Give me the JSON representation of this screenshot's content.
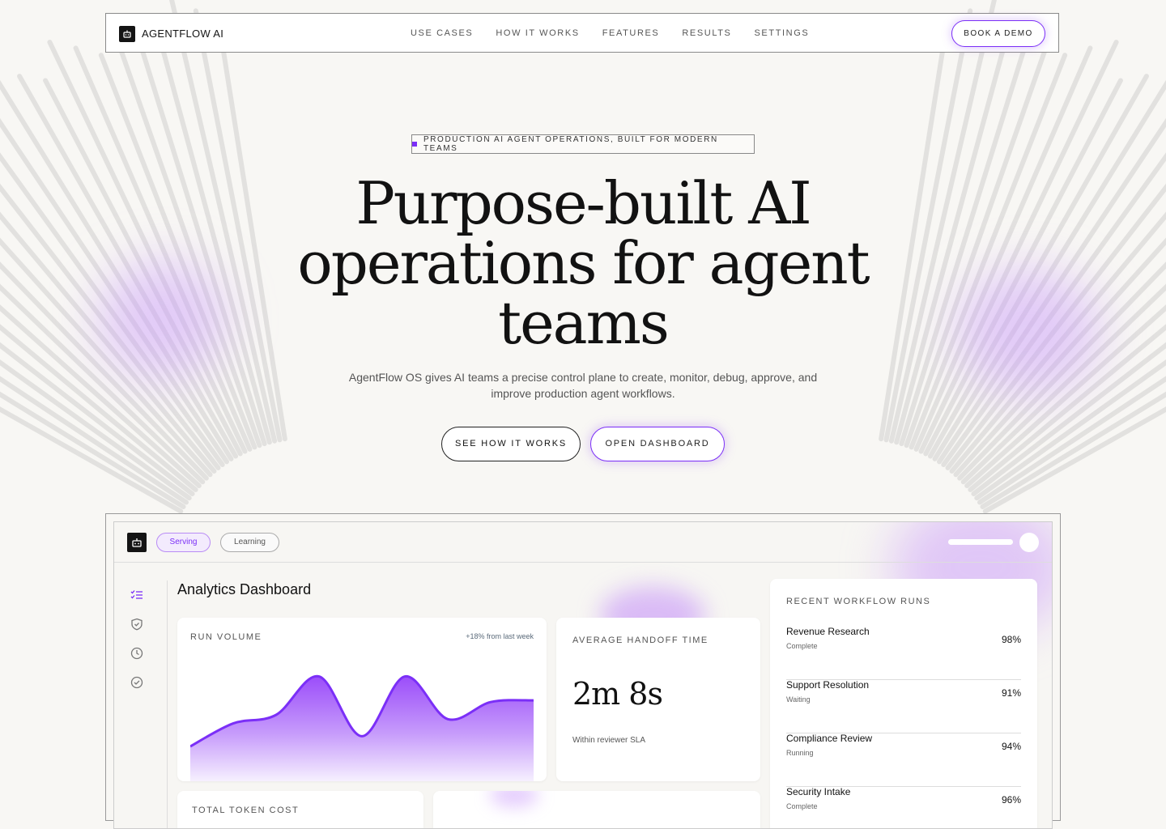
{
  "nav": {
    "brand": "AGENTFLOW AI",
    "links": [
      "USE CASES",
      "HOW IT WORKS",
      "FEATURES",
      "RESULTS",
      "SETTINGS"
    ],
    "cta": "BOOK A DEMO"
  },
  "hero": {
    "eyebrow": "PRODUCTION AI AGENT OPERATIONS, BUILT FOR MODERN TEAMS",
    "headline": "Purpose-built AI operations for agent teams",
    "subtitle": "AgentFlow OS gives AI teams a precise control plane to create, monitor, debug, approve, and improve production agent workflows.",
    "primary_cta": "SEE HOW IT WORKS",
    "secondary_cta": "OPEN DASHBOARD"
  },
  "dashboard": {
    "tabs": [
      "Serving",
      "Learning"
    ],
    "active_tab": "Serving",
    "sidebar_icons": [
      "checklist-icon",
      "shield-icon",
      "clock-icon",
      "check-circle-icon"
    ],
    "title": "Analytics Dashboard",
    "run_volume": {
      "label": "RUN VOLUME",
      "change": "+18% from last week"
    },
    "handoff": {
      "label": "AVERAGE HANDOFF TIME",
      "value": "2m 8s",
      "note": "Within reviewer SLA"
    },
    "cost_label": "TOTAL TOKEN COST",
    "recent_runs": {
      "label": "RECENT WORKFLOW RUNS",
      "items": [
        {
          "name": "Revenue Research",
          "status": "Complete",
          "score": "98%"
        },
        {
          "name": "Support Resolution",
          "status": "Waiting",
          "score": "91%"
        },
        {
          "name": "Compliance Review",
          "status": "Running",
          "score": "94%"
        },
        {
          "name": "Security Intake",
          "status": "Complete",
          "score": "96%"
        }
      ]
    }
  },
  "chart_data": {
    "type": "area",
    "title": "RUN VOLUME",
    "x": [
      0,
      1,
      2,
      3,
      4,
      5,
      6,
      7,
      8
    ],
    "values": [
      18,
      45,
      55,
      100,
      30,
      100,
      50,
      70,
      72
    ],
    "ylim": [
      0,
      110
    ]
  },
  "colors": {
    "accent": "#7b2ff7",
    "background": "#f8f7f4"
  }
}
